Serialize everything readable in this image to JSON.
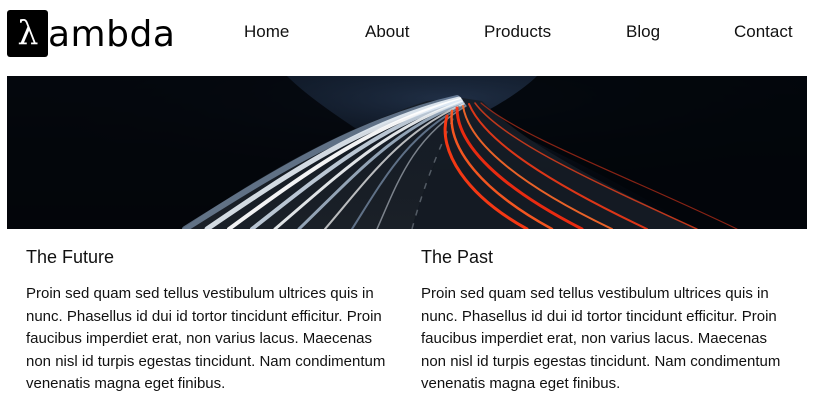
{
  "brand": {
    "logo_glyph": "λ",
    "logo_text": "ambda"
  },
  "nav": {
    "items": [
      "Home",
      "About",
      "Products",
      "Blog",
      "Contact"
    ]
  },
  "hero": {
    "image": "night-highway-light-trails"
  },
  "sections": [
    {
      "title": "The Future",
      "body": "Proin sed quam sed tellus vestibulum ultrices quis in nunc. Phasellus id dui id tortor tincidunt efficitur. Proin faucibus imperdiet erat, non varius lacus. Maecenas non nisl id turpis egestas tincidunt. Nam condimentum venenatis magna eget finibus."
    },
    {
      "title": "The Past",
      "body": "Proin sed quam sed tellus vestibulum ultrices quis in nunc. Phasellus id dui id tortor tincidunt efficitur. Proin faucibus imperdiet erat, non varius lacus. Maecenas non nisl id turpis egestas tincidunt. Nam condimentum venenatis magna eget finibus."
    }
  ],
  "colors": {
    "text": "#111111",
    "logo_bg": "#000000",
    "hero_bg": "#03070d",
    "trail_white": "#dfe8f2",
    "trail_red": "#ff4a1c"
  }
}
